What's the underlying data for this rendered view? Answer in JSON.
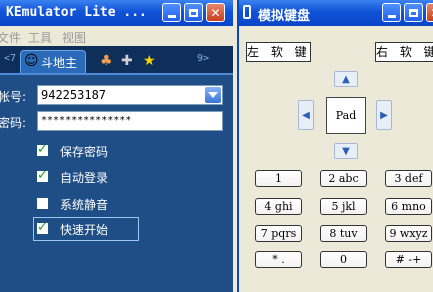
{
  "left_window": {
    "title": "KEmulator Lite ...",
    "menu": [
      "文件",
      "工具",
      "视图"
    ],
    "tabs": {
      "prev": "<7",
      "active": "斗地主",
      "next": "9>"
    },
    "account_label": "帐号:",
    "account_value": "942253187",
    "password_label": "密码:",
    "password_value": "***************",
    "options": [
      {
        "label": "保存密码",
        "checked": true
      },
      {
        "label": "自动登录",
        "checked": true
      },
      {
        "label": "系统静音",
        "checked": false
      },
      {
        "label": "快速开始",
        "checked": true
      }
    ]
  },
  "right_window": {
    "title": "模拟键盘",
    "left_soft": "左 软 键",
    "right_soft": "右 软 键",
    "pad": "Pad",
    "keys": [
      [
        "1",
        "2 abc",
        "3 def"
      ],
      [
        "4 ghi",
        "5 jkl",
        "6 mno"
      ],
      [
        "7 pqrs",
        "8 tuv",
        "9 wxyz"
      ],
      [
        "* .",
        "0",
        "# -+"
      ]
    ]
  }
}
